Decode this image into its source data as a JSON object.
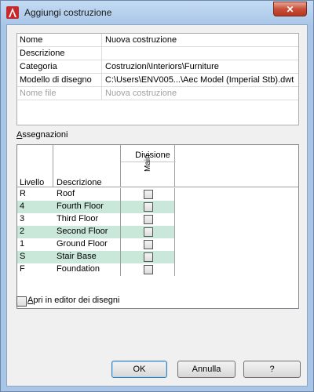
{
  "window": {
    "title": "Aggiungi costruzione",
    "close_symbol": "✕"
  },
  "properties": [
    {
      "key": "Nome",
      "value": "Nuova costruzione",
      "disabled": false
    },
    {
      "key": "Descrizione",
      "value": "",
      "disabled": false
    },
    {
      "key": "Categoria",
      "value": "Costruzioni\\Interiors\\Furniture",
      "disabled": false
    },
    {
      "key": "Modello di disegno",
      "value": "C:\\Users\\ENV005...\\Aec Model (Imperial Stb).dwt",
      "disabled": false
    },
    {
      "key": "Nome file",
      "value": "Nuova costruzione",
      "disabled": true
    }
  ],
  "assignments": {
    "label_prefix": "A",
    "label_rest": "ssegnazioni",
    "col_level": "Livello",
    "col_description": "Descrizione",
    "col_division": "Divisione",
    "col_division_sub": "Main",
    "rows": [
      {
        "level": "R",
        "description": "Roof",
        "checked": false
      },
      {
        "level": "4",
        "description": "Fourth Floor",
        "checked": false
      },
      {
        "level": "3",
        "description": "Third Floor",
        "checked": false
      },
      {
        "level": "2",
        "description": "Second Floor",
        "checked": false
      },
      {
        "level": "1",
        "description": "Ground Floor",
        "checked": false
      },
      {
        "level": "S",
        "description": "Stair Base",
        "checked": false
      },
      {
        "level": "F",
        "description": "Foundation",
        "checked": false
      }
    ]
  },
  "open_in_editor": {
    "label_prefix": "A",
    "label_rest": "pri in editor dei disegni",
    "checked": false
  },
  "buttons": {
    "ok": "OK",
    "cancel": "Annulla",
    "help": "?"
  },
  "colors": {
    "alt_row": "#c9e8d9",
    "title_bar": "#aac6e6",
    "close_button": "#c7503a"
  },
  "icons": {
    "app": "autocad-logo-icon",
    "close": "close-icon",
    "checkbox": "checkbox-icon"
  }
}
